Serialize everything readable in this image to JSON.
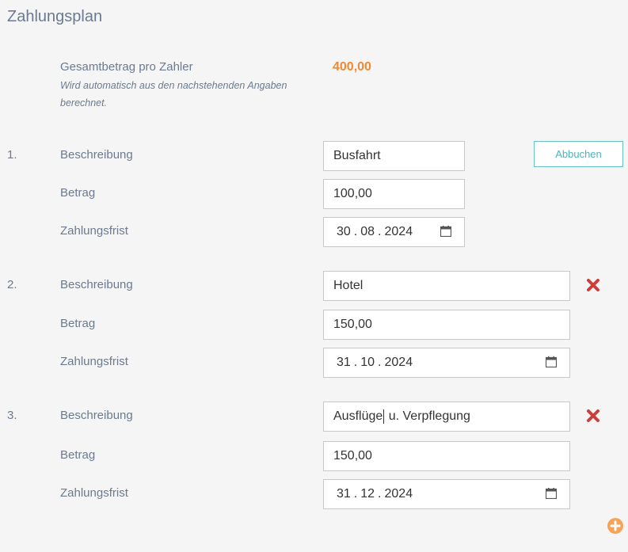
{
  "title": "Zahlungsplan",
  "total": {
    "label": "Gesamtbetrag pro Zahler",
    "hint": "Wird automatisch aus den nachstehenden Angaben berechnet.",
    "value": "400,00"
  },
  "labels": {
    "description": "Beschreibung",
    "amount": "Betrag",
    "due": "Zahlungsfrist"
  },
  "items": [
    {
      "num": "1.",
      "description": "Busfahrt",
      "amount": "100,00",
      "due_day": "30",
      "due_month": "08",
      "due_year": "2024",
      "action": "Abbuchen"
    },
    {
      "num": "2.",
      "description": "Hotel",
      "amount": "150,00",
      "due_day": "31",
      "due_month": "10",
      "due_year": "2024"
    },
    {
      "num": "3.",
      "description_a": "Ausflüge",
      "description_b": " u. Verpflegung",
      "amount": "150,00",
      "due_day": "31",
      "due_month": "12",
      "due_year": "2024"
    }
  ],
  "date_sep": ".",
  "colors": {
    "accent": "#f08a32",
    "delete": "#c9403a",
    "button": "#4fb2bd"
  },
  "icons": {
    "calendar": "calendar-icon",
    "delete": "delete-icon",
    "add": "add-icon"
  }
}
